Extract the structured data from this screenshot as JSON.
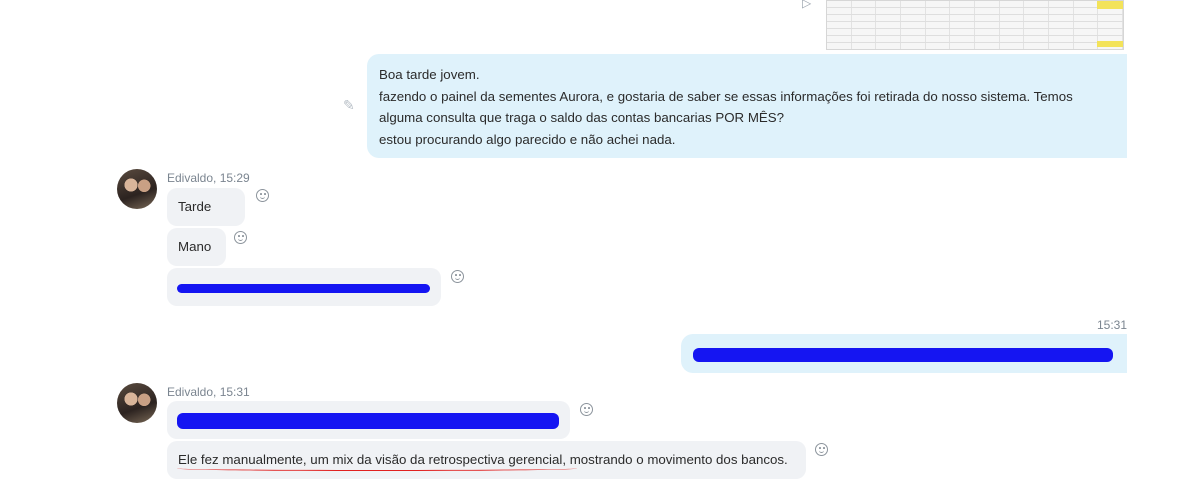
{
  "attachment": {
    "name": "spreadsheet-thumbnail"
  },
  "outgoing_1": {
    "lines": [
      "Boa tarde jovem.",
      "fazendo o painel da sementes Aurora, e gostaria de saber se essas informações foi retirada do nosso sistema. Temos",
      "alguma consulta que traga o saldo das contas bancarias POR MÊS?",
      "estou procurando algo parecido e não achei nada."
    ]
  },
  "group_1": {
    "sender": "Edivaldo, 15:29",
    "messages": [
      "Tarde",
      "Mano"
    ]
  },
  "outgoing_2": {
    "time": "15:31"
  },
  "group_2": {
    "sender": "Edivaldo, 15:31",
    "message": "Ele fez manualmente, um mix da visão da retrospectiva gerencial, mostrando o movimento dos bancos."
  },
  "colors": {
    "outgoing_bubble": "#dff2fb",
    "incoming_bubble": "#f0f2f5",
    "redaction": "#1515f2",
    "spellcheck": "#e0201f"
  },
  "icons": [
    "edit-icon",
    "reaction-icon",
    "send-icon",
    "avatar"
  ]
}
